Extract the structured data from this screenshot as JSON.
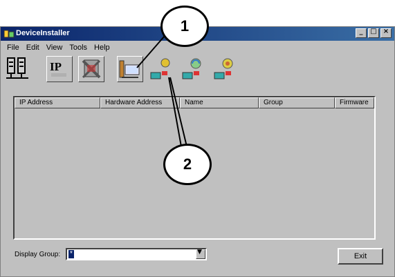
{
  "window": {
    "title": "DeviceInstaller",
    "icon": "app-icon",
    "controls": [
      "minimize-icon",
      "maximize-icon",
      "close-icon"
    ]
  },
  "menu": [
    "File",
    "Edit",
    "View",
    "Tools",
    "Help"
  ],
  "toolbar": {
    "buttons": [
      {
        "name": "search-network-button",
        "icon": "network-search-icon"
      },
      {
        "name": "assign-ip-button",
        "icon": "ip-icon",
        "text": "IP"
      },
      {
        "name": "upgrade-button",
        "icon": "upgrade-icon"
      },
      {
        "name": "web-config-button",
        "icon": "web-config-icon"
      },
      {
        "name": "telnet-config-button",
        "icon": "telnet-config-icon"
      },
      {
        "name": "ping-button",
        "icon": "ping-icon"
      },
      {
        "name": "options-button",
        "icon": "options-icon"
      }
    ]
  },
  "table": {
    "columns": [
      "IP Address",
      "Hardware Address",
      "Name",
      "Group",
      "Firmware"
    ],
    "rows": []
  },
  "footer": {
    "display_group_label": "Display Group:",
    "display_group_value": "*",
    "exit_label": "Exit"
  },
  "callouts": [
    {
      "label": "1"
    },
    {
      "label": "2"
    }
  ]
}
